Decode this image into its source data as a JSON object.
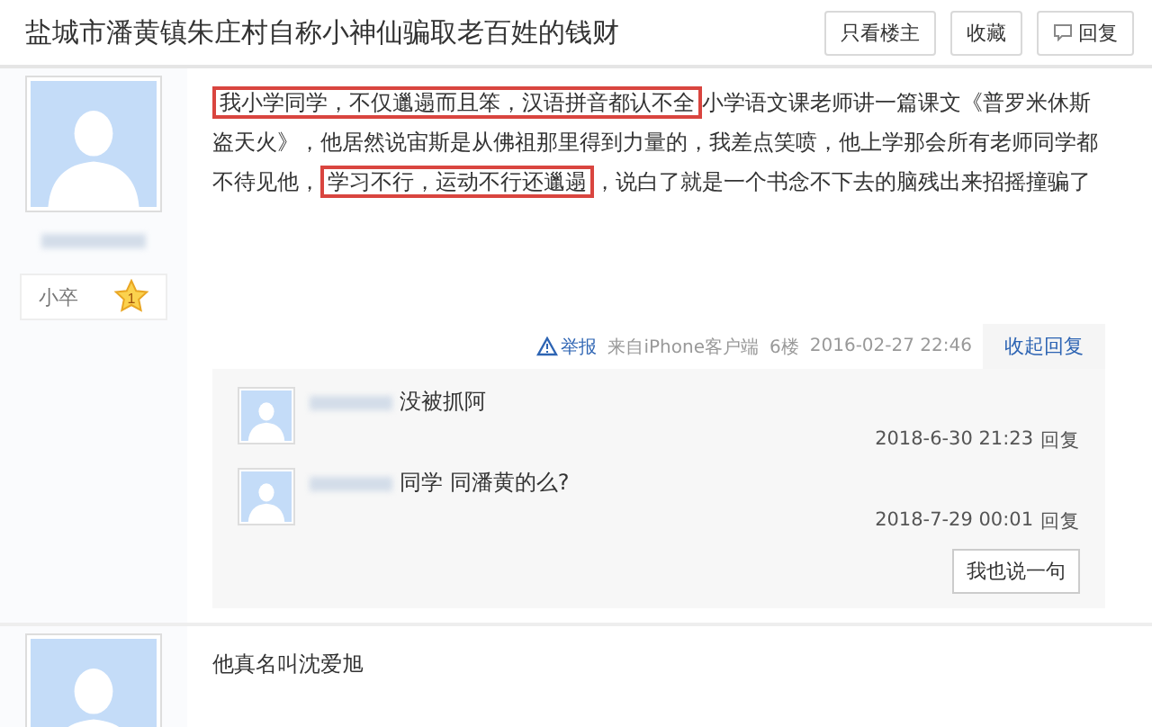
{
  "thread": {
    "title": "盐城市潘黄镇朱庄村自称小神仙骗取老百姓的钱财",
    "buttons": [
      "只看楼主",
      "收藏",
      "回复"
    ]
  },
  "posts": [
    {
      "author": {
        "rank": "小卒",
        "level": "1"
      },
      "body": [
        {
          "text": "我小学同学，不仅邋遢而且笨，汉语拼音都认不全",
          "highlighted": true
        },
        {
          "text": "小学语文课老师讲一篇课文《普罗米休斯盗天火》，他居然说宙斯是从佛祖那里得到力量的，我差点笑喷，他上学那会所有老师同学都不待见他，",
          "highlighted": false
        },
        {
          "text": "学习不行，运动不行还邋遢",
          "highlighted": true
        },
        {
          "text": "，说白了就是一个书念不下去的脑残出来招摇撞骗了",
          "highlighted": false
        }
      ],
      "footer": {
        "report": "举报",
        "source": "来自iPhone客户端",
        "floor": "6楼",
        "time": "2016-02-27 22:46",
        "toggle": "收起回复"
      },
      "replies": [
        {
          "text": "没被抓阿",
          "time": "2018-6-30 21:23",
          "action": "回复"
        },
        {
          "text": "同学 同潘黄的么?",
          "time": "2018-7-29 00:01",
          "action": "回复"
        }
      ],
      "reply_button": "我也说一句"
    },
    {
      "body": [
        {
          "text": "他真名叫沈爱旭",
          "highlighted": false
        }
      ]
    }
  ]
}
